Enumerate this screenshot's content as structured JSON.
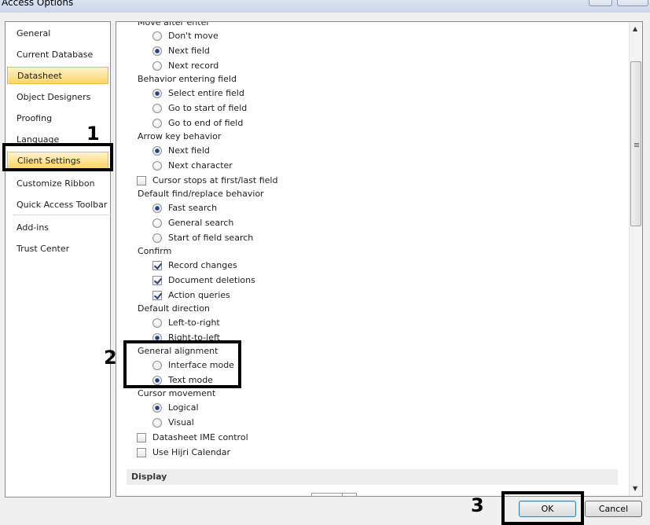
{
  "window": {
    "title": "Access Options"
  },
  "sidebar": {
    "items": [
      {
        "label": "General",
        "active": false
      },
      {
        "label": "Current Database",
        "active": false
      },
      {
        "label": "Datasheet",
        "active": true
      },
      {
        "label": "Object Designers",
        "active": false
      },
      {
        "label": "Proofing",
        "active": false
      },
      {
        "label": "Language",
        "active": false
      },
      {
        "label": "Client Settings",
        "active": true
      },
      {
        "label": "Customize Ribbon",
        "active": false
      },
      {
        "label": "Quick Access Toolbar",
        "active": false
      },
      {
        "label": "Add-ins",
        "active": false
      },
      {
        "label": "Trust Center",
        "active": false
      }
    ]
  },
  "content": {
    "move_after_enter": {
      "label": "Move after enter",
      "options": [
        {
          "label": "Don't move",
          "checked": false
        },
        {
          "label": "Next field",
          "checked": true
        },
        {
          "label": "Next record",
          "checked": false
        }
      ]
    },
    "behavior_entering_field": {
      "label": "Behavior entering field",
      "options": [
        {
          "label": "Select entire field",
          "checked": true
        },
        {
          "label": "Go to start of field",
          "checked": false
        },
        {
          "label": "Go to end of field",
          "checked": false
        }
      ]
    },
    "arrow_key_behavior": {
      "label": "Arrow key behavior",
      "options": [
        {
          "label": "Next field",
          "checked": true
        },
        {
          "label": "Next character",
          "checked": false
        }
      ]
    },
    "cursor_stops": {
      "label": "Cursor stops at first/last field",
      "checked": false
    },
    "find_replace": {
      "label": "Default find/replace behavior",
      "options": [
        {
          "label": "Fast search",
          "checked": true
        },
        {
          "label": "General search",
          "checked": false
        },
        {
          "label": "Start of field search",
          "checked": false
        }
      ]
    },
    "confirm": {
      "label": "Confirm",
      "options": [
        {
          "label": "Record changes",
          "checked": true
        },
        {
          "label": "Document deletions",
          "checked": true
        },
        {
          "label": "Action queries",
          "checked": true
        }
      ]
    },
    "default_direction": {
      "label": "Default direction",
      "options": [
        {
          "label": "Left-to-right",
          "checked": false
        },
        {
          "label": "Right-to-left",
          "checked": true
        }
      ]
    },
    "general_alignment": {
      "label": "General alignment",
      "options": [
        {
          "label": "Interface mode",
          "checked": false
        },
        {
          "label": "Text mode",
          "checked": true
        }
      ]
    },
    "cursor_movement": {
      "label": "Cursor movement",
      "options": [
        {
          "label": "Logical",
          "checked": true
        },
        {
          "label": "Visual",
          "checked": false
        }
      ]
    },
    "datasheet_ime": {
      "label": "Datasheet IME control",
      "checked": false
    },
    "hijri": {
      "label": "Use Hijri Calendar",
      "checked": false
    },
    "display_section": "Display"
  },
  "buttons": {
    "ok": "OK",
    "cancel": "Cancel"
  },
  "annotations": {
    "one": "1",
    "two": "2",
    "three": "3"
  }
}
